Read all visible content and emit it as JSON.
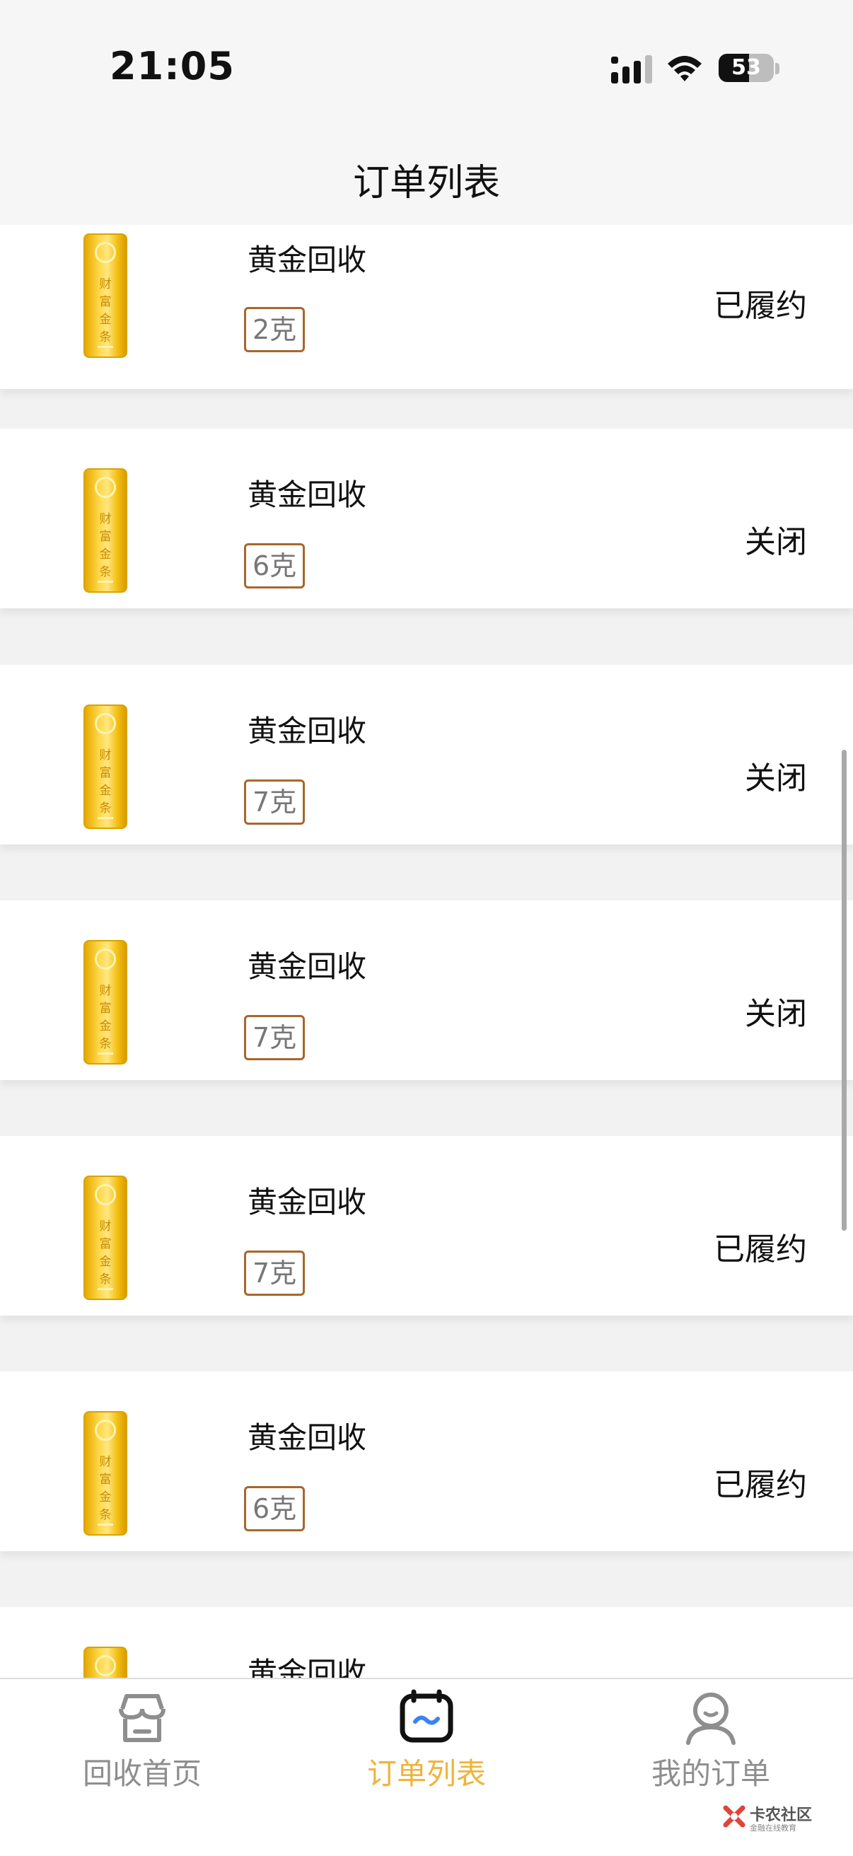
{
  "status_bar": {
    "time": "21:05",
    "battery": "53"
  },
  "header": {
    "title": "订单列表"
  },
  "orders": [
    {
      "title": "黄金回收",
      "weight": "2克",
      "status": "已履约"
    },
    {
      "title": "黄金回收",
      "weight": "6克",
      "status": "关闭"
    },
    {
      "title": "黄金回收",
      "weight": "7克",
      "status": "关闭"
    },
    {
      "title": "黄金回收",
      "weight": "7克",
      "status": "关闭"
    },
    {
      "title": "黄金回收",
      "weight": "7克",
      "status": "已履约"
    },
    {
      "title": "黄金回收",
      "weight": "6克",
      "status": "已履约"
    },
    {
      "title": "黄金回收",
      "weight": "",
      "status": ""
    }
  ],
  "gold_bar_text": "财富金条",
  "tabs": [
    {
      "label": "回收首页",
      "icon": "shop-icon",
      "active": false
    },
    {
      "label": "订单列表",
      "icon": "calendar-icon",
      "active": true
    },
    {
      "label": "我的订单",
      "icon": "person-icon",
      "active": false
    }
  ],
  "watermark": {
    "text": "卡农社区",
    "sub": "金融在线教育"
  },
  "colors": {
    "accent": "#f0b43c",
    "tag_border": "#a7672e",
    "gold": "#ffd84a"
  }
}
